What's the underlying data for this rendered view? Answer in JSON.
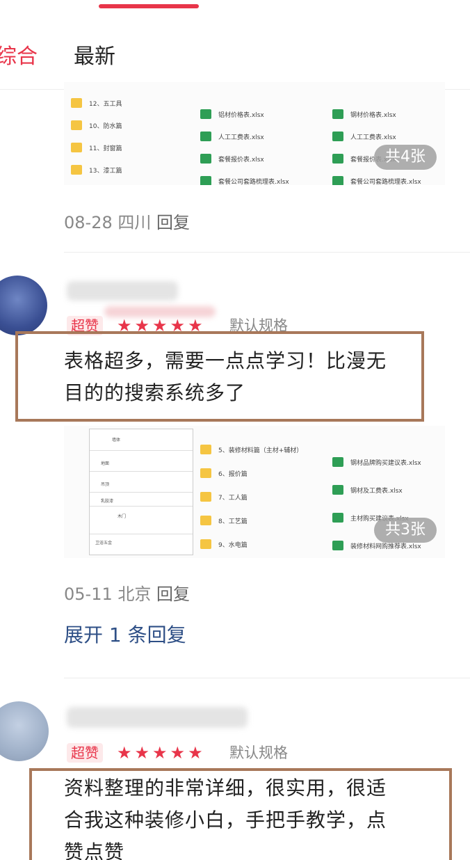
{
  "tabs": [
    {
      "label": "综合",
      "active": true
    },
    {
      "label": "最新",
      "active": false
    }
  ],
  "colors": {
    "accent": "#e8354a",
    "link": "#2e4f86",
    "box": "#a8785a"
  },
  "reviews": [
    {
      "images": {
        "badge": "共4张",
        "folders": [
          "12、五工具",
          "10、防水篇",
          "11、封窗篇",
          "13、漆工篇"
        ],
        "files_a": [
          "铝材价格表.xlsx",
          "人工工费表.xlsx",
          "套餐报价表.xlsx",
          "套餐公司套路梳理表.xlsx"
        ],
        "files_b": [
          "钢材价格表.xlsx",
          "人工工费表.xlsx",
          "套餐报价表.xlsx",
          "套餐公司套路梳理表.xlsx"
        ]
      },
      "date": "08-28",
      "region": "四川",
      "reply_label": "回复"
    },
    {
      "tag": "超赞",
      "rating": 5,
      "spec": "默认规格",
      "comment_lines": [
        "表格超多，需要一点点学习！比漫无",
        "目的的搜索系统多了"
      ],
      "images": {
        "badge": "共3张",
        "table_rows": [
          "墙体",
          "地面",
          "吊顶",
          "卫浴五金",
          "乳胶漆",
          "木门"
        ],
        "folders": [
          "5、装修材料篇（主材+辅材）",
          "6、报价篇",
          "7、工人篇",
          "8、工艺篇",
          "9、水电篇"
        ],
        "files": [
          "钢材品牌购买建议表.xlsx",
          "钢材及工费表.xlsx",
          "主材购买建议表.xlsx",
          "装修材料网购推荐表.xlsx"
        ]
      },
      "date": "05-11",
      "region": "北京",
      "reply_label": "回复",
      "expand_label": "展开 1 条回复"
    },
    {
      "tag": "超赞",
      "rating": 5,
      "spec": "默认规格",
      "comment_lines": [
        "资料整理的非常详细，很实用，很适",
        "合我这种装修小白，手把手教学，点",
        "赞点赞"
      ]
    }
  ]
}
